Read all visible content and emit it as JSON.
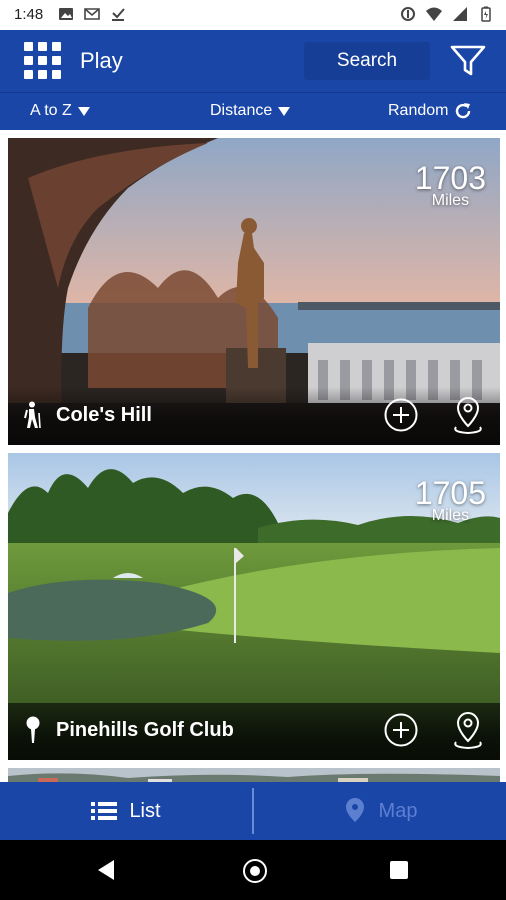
{
  "status_bar": {
    "time": "1:48"
  },
  "app_bar": {
    "title": "Play",
    "search_label": "Search"
  },
  "sort_bar": {
    "a_to_z": "A to Z",
    "distance": "Distance",
    "random": "Random"
  },
  "cards": [
    {
      "name": "Cole's Hill",
      "distance": "1703",
      "unit": "Miles",
      "category_icon": "hiking-icon"
    },
    {
      "name": "Pinehills Golf Club",
      "distance": "1705",
      "unit": "Miles",
      "category_icon": "golf-icon"
    }
  ],
  "tabs": {
    "list": "List",
    "map": "Map"
  },
  "colors": {
    "primary": "#1a46a8",
    "search_bg": "#173e97",
    "inactive_tab": "#5d7fd0"
  }
}
